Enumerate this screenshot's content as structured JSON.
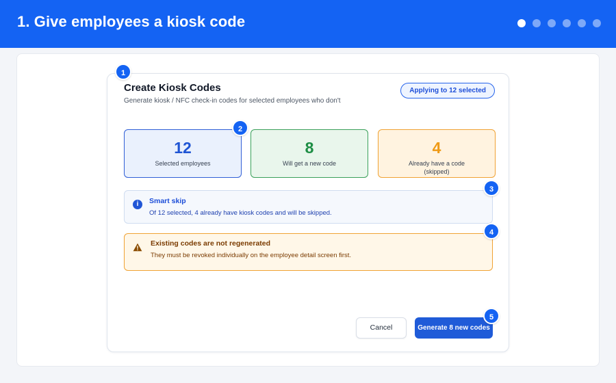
{
  "header": {
    "title": "1. Give employees a kiosk code",
    "step_dots": [
      true,
      false,
      false,
      false,
      false,
      false
    ]
  },
  "dialog": {
    "title": "Create Kiosk Codes",
    "subtitle": "Generate kiosk / NFC check-in codes for selected employees who don't",
    "pill": "Applying to 12 selected"
  },
  "stats": [
    {
      "value": "12",
      "label": "Selected employees"
    },
    {
      "value": "8",
      "label": "Will get a new code"
    },
    {
      "value": "4",
      "label": "Already have a code",
      "label2": "(skipped)"
    }
  ],
  "info": {
    "icon": "info-icon",
    "title": "Smart skip",
    "text": "Of 12 selected, 4 already have kiosk codes and will be skipped."
  },
  "warning": {
    "icon": "warning-icon",
    "title": "Existing codes are not regenerated",
    "text": "They must be revoked individually on the employee detail screen first."
  },
  "actions": {
    "cancel": "Cancel",
    "generate": "Generate 8 new codes"
  },
  "badges": [
    "1",
    "2",
    "3",
    "4",
    "5"
  ],
  "colors": {
    "primary": "#1463f3",
    "success": "#1e8e45",
    "warning": "#ef9a16"
  }
}
